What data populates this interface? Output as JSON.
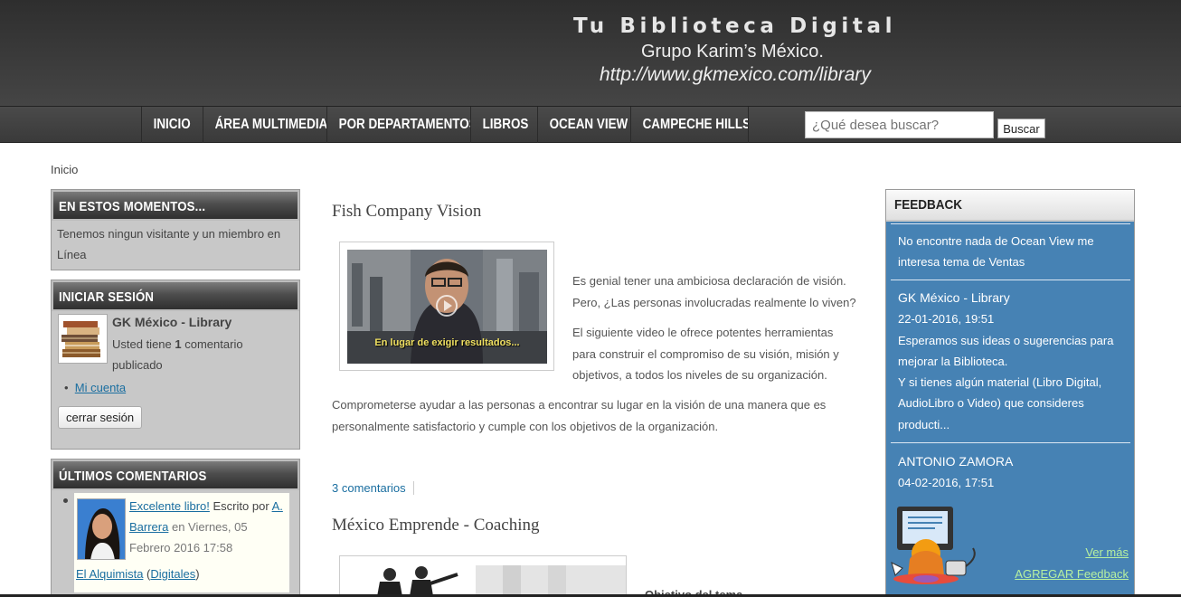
{
  "header": {
    "title": "Tu Biblioteca Digital",
    "subtitle": "Grupo Karim’s México.",
    "url": "http://www.gkmexico.com/library"
  },
  "nav": {
    "items": [
      {
        "label": "INICIO"
      },
      {
        "label": "ÁREA MULTIMEDIA"
      },
      {
        "label": "POR DEPARTAMENTOS"
      },
      {
        "label": "LIBROS"
      },
      {
        "label": "OCEAN VIEW"
      },
      {
        "label": "CAMPECHE HILLS"
      }
    ],
    "search_placeholder": "¿Qué desea buscar?",
    "search_button": "Buscar"
  },
  "breadcrumb": "Inicio",
  "blocks": {
    "online": {
      "title": "EN ESTOS MOMENTOS...",
      "text": "Tenemos ningun visitante y un miembro en Línea"
    },
    "login": {
      "title": "INICIAR SESIÓN",
      "user": "GK México - Library",
      "comments_prefix": "Usted tiene",
      "comments_count": "1",
      "comments_suffix": "comentario publicado",
      "my_account": "Mi cuenta",
      "logout": "cerrar sesión"
    },
    "comments": {
      "title": "ÚLTIMOS COMENTARIOS",
      "comment_link": "Excelente libro!",
      "written_by": "Escrito por",
      "author": "A. Barrera",
      "date": "en Viernes, 05 Febrero 2016 17:58",
      "tag1": "El Alquimista",
      "tag2": "Digitales"
    }
  },
  "articles": [
    {
      "title": "Fish Company Vision",
      "video_caption": "En lugar de exigir resultados...",
      "p1": "Es genial tener una ambiciosa declaración de visión. Pero, ¿Las personas involucradas realmente lo viven?",
      "p2": "El siguiente video le ofrece potentes herramientas para construir el compromiso de su visión, misión y objetivos, a todos los niveles de su organización.",
      "p3": "Comprometerse ayudar a las personas a encontrar su lugar en la visión de una manera que es personalmente satisfactorio y cumple con los objetivos de la organización.",
      "comments": "3 comentarios"
    },
    {
      "title": "México Emprende - Coaching",
      "snippet": "Objetivo del tema"
    }
  ],
  "feedback": {
    "title": "FEEDBACK",
    "entries": [
      {
        "text": "No encontre nada de Ocean View me interesa tema de Ventas"
      },
      {
        "author": "GK México - Library",
        "date": "22-01-2016, 19:51",
        "text1": "Esperamos sus ideas o sugerencias para mejorar la Biblioteca.",
        "text2": "Y si tienes algún material (Libro Digital, AudioLibro o Video) que consideres producti..."
      },
      {
        "author": "ANTONIO ZAMORA",
        "date": "04-02-2016, 17:51"
      }
    ],
    "more": "Ver más",
    "add": "AGREGAR Feedback"
  }
}
